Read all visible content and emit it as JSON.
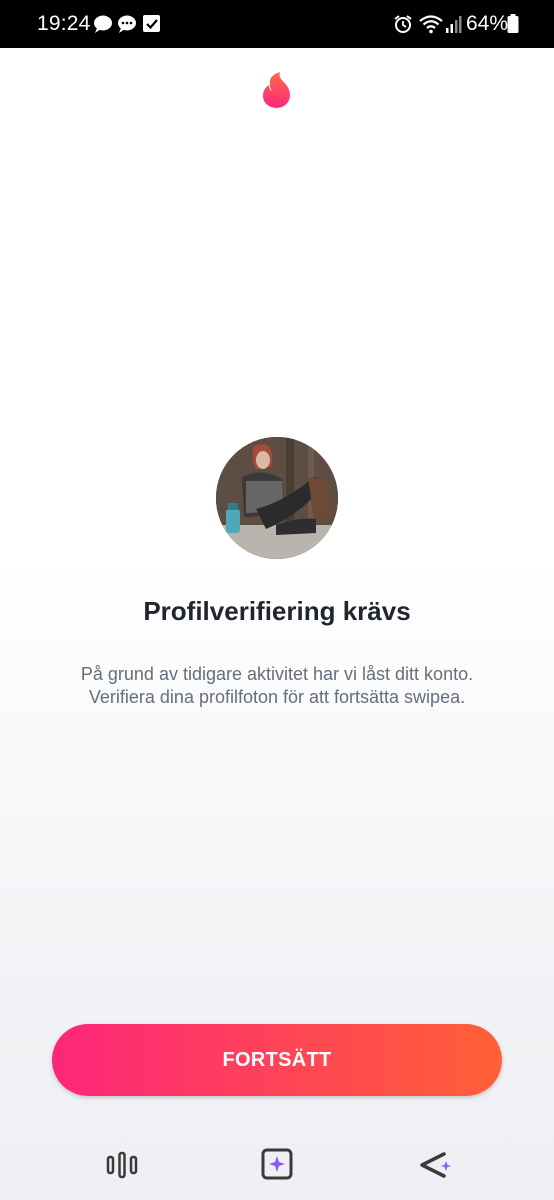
{
  "status_bar": {
    "time": "19:24",
    "battery": "64%",
    "left_icons": [
      "chat-bubble-icon",
      "chat-bubbles-icon",
      "checkbox-icon"
    ],
    "right_icons": [
      "alarm-icon",
      "wifi-icon",
      "signal-icon",
      "battery-icon"
    ]
  },
  "app": {
    "logo_icon": "tinder-flame-icon",
    "brand_color": "#fe3c72"
  },
  "verification": {
    "title": "Profilverifiering krävs",
    "description": "På grund av tidigare aktivitet har vi låst ditt konto. Verifiera dina profilfoton för att fortsätta swipea.",
    "continue_label": "FORTSÄTT",
    "button_gradient": [
      "#fd267a",
      "#ff6036"
    ]
  },
  "navigation": {
    "items": [
      "recent-apps-icon",
      "home-icon",
      "back-icon"
    ]
  }
}
